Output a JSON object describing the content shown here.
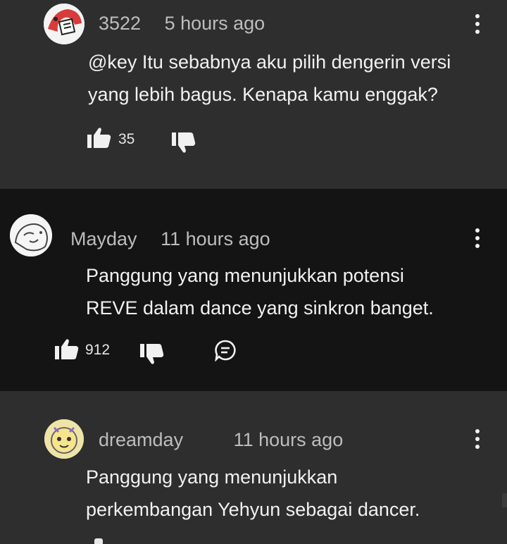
{
  "comments": [
    {
      "author": "3522",
      "time": "5 hours ago",
      "text_lines": [
        "@key Itu sebabnya aku pilih dengerin versi",
        "yang lebih bagus. Kenapa kamu enggak?"
      ],
      "likes": "35",
      "avatar_icon": "red-cartoon-avatar"
    },
    {
      "author": "Mayday",
      "time": "11 hours ago",
      "text_lines": [
        "Panggung yang menunjukkan potensi",
        "REVE dalam dance yang sinkron banget."
      ],
      "likes": "912",
      "avatar_icon": "sketch-cartoon-avatar"
    },
    {
      "author": "dreamday",
      "time": "11 hours ago",
      "text_lines": [
        "Panggung yang menunjukkan",
        "perkembangan Yehyun sebagai dancer."
      ],
      "avatar_icon": "yellow-cartoon-avatar"
    }
  ],
  "icons": {
    "like": "thumbs-up-icon",
    "dislike": "thumbs-down-icon",
    "reply": "reply-icon",
    "menu": "more-vert-icon"
  },
  "colors": {
    "bg_light": "#2e2e2e",
    "bg_dark": "#141414",
    "text": "#f1f1f1",
    "meta": "#bdbdbd"
  }
}
